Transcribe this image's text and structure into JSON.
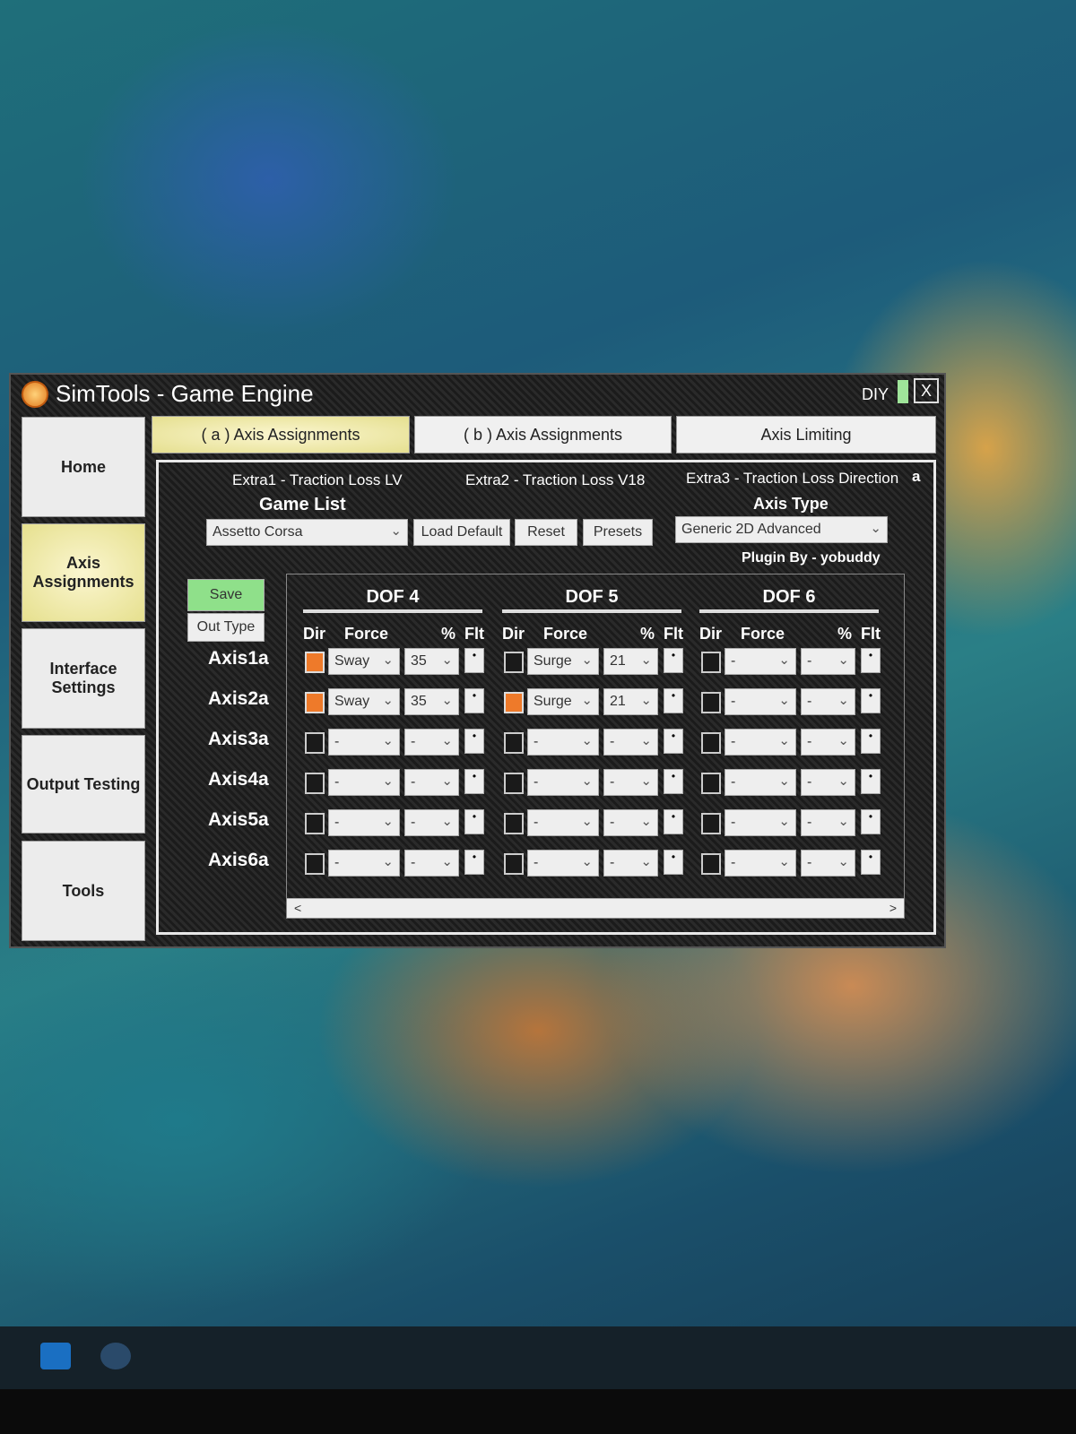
{
  "window": {
    "title": "SimTools - Game Engine",
    "mode": "DIY",
    "close": "X"
  },
  "sidebar": [
    {
      "label": "Home"
    },
    {
      "label": "Axis Assignments"
    },
    {
      "label": "Interface Settings"
    },
    {
      "label": "Output Testing"
    },
    {
      "label": "Tools"
    }
  ],
  "tabs": [
    {
      "label": "( a ) Axis Assignments"
    },
    {
      "label": "( b ) Axis Assignments"
    },
    {
      "label": "Axis Limiting"
    }
  ],
  "extras": [
    "Extra1 - Traction Loss LV",
    "Extra2 - Traction Loss V18",
    "Extra3 - Traction Loss Direction"
  ],
  "extra_marker": "a",
  "game_list": {
    "heading": "Game List",
    "value": "Assetto Corsa",
    "load_default": "Load Default",
    "reset": "Reset",
    "presets": "Presets"
  },
  "axis_type": {
    "heading": "Axis Type",
    "value": "Generic 2D Advanced"
  },
  "plugin_by": "Plugin By - yobuddy",
  "save": "Save",
  "out_type": "Out Type",
  "columns": {
    "dir": "Dir",
    "force": "Force",
    "pct": "%",
    "flt": "Flt"
  },
  "dofs": [
    "DOF 4",
    "DOF 5",
    "DOF 6"
  ],
  "axes": [
    {
      "name": "Axis1a",
      "cells": [
        {
          "dir": true,
          "force": "Sway",
          "pct": "35"
        },
        {
          "dir": false,
          "force": "Surge",
          "pct": "21"
        },
        {
          "dir": false,
          "force": "-",
          "pct": "-"
        }
      ]
    },
    {
      "name": "Axis2a",
      "cells": [
        {
          "dir": true,
          "force": "Sway",
          "pct": "35"
        },
        {
          "dir": true,
          "force": "Surge",
          "pct": "21"
        },
        {
          "dir": false,
          "force": "-",
          "pct": "-"
        }
      ]
    },
    {
      "name": "Axis3a",
      "cells": [
        {
          "dir": false,
          "force": "-",
          "pct": "-"
        },
        {
          "dir": false,
          "force": "-",
          "pct": "-"
        },
        {
          "dir": false,
          "force": "-",
          "pct": "-"
        }
      ]
    },
    {
      "name": "Axis4a",
      "cells": [
        {
          "dir": false,
          "force": "-",
          "pct": "-"
        },
        {
          "dir": false,
          "force": "-",
          "pct": "-"
        },
        {
          "dir": false,
          "force": "-",
          "pct": "-"
        }
      ]
    },
    {
      "name": "Axis5a",
      "cells": [
        {
          "dir": false,
          "force": "-",
          "pct": "-"
        },
        {
          "dir": false,
          "force": "-",
          "pct": "-"
        },
        {
          "dir": false,
          "force": "-",
          "pct": "-"
        }
      ]
    },
    {
      "name": "Axis6a",
      "cells": [
        {
          "dir": false,
          "force": "-",
          "pct": "-"
        },
        {
          "dir": false,
          "force": "-",
          "pct": "-"
        },
        {
          "dir": false,
          "force": "-",
          "pct": "-"
        }
      ]
    }
  ],
  "flt_mark": "•",
  "scroll": {
    "left": "<",
    "right": ">"
  },
  "colors": {
    "dir_on": "#ee7a2a",
    "active_tab": "#e5df8f",
    "save": "#8fe08a"
  }
}
